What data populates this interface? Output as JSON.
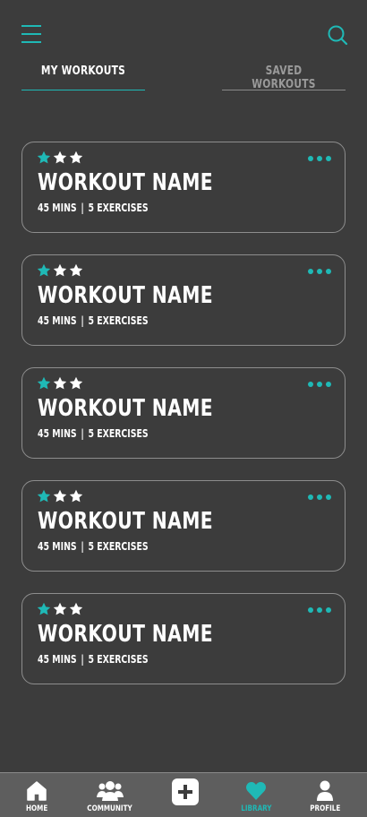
{
  "colors": {
    "background": "#3c3c3c",
    "accent": "#1fb9b6",
    "nav_bg": "#5e5e5e"
  },
  "header": {
    "menu_icon": "hamburger-icon",
    "search_icon": "search-icon"
  },
  "tabs": [
    {
      "label": "MY WORKOUTS",
      "active": true
    },
    {
      "label": "SAVED WORKOUTS",
      "active": false
    }
  ],
  "workouts": [
    {
      "title": "WORKOUT NAME",
      "duration": "45 MINS",
      "separator": "|",
      "exercises": "5 EXERCISES",
      "difficulty": 1,
      "max_difficulty": 3
    },
    {
      "title": "WORKOUT NAME",
      "duration": "45 MINS",
      "separator": "|",
      "exercises": "5 EXERCISES",
      "difficulty": 1,
      "max_difficulty": 3
    },
    {
      "title": "WORKOUT NAME",
      "duration": "45 MINS",
      "separator": "|",
      "exercises": "5 EXERCISES",
      "difficulty": 1,
      "max_difficulty": 3
    },
    {
      "title": "WORKOUT NAME",
      "duration": "45 MINS",
      "separator": "|",
      "exercises": "5 EXERCISES",
      "difficulty": 1,
      "max_difficulty": 3
    },
    {
      "title": "WORKOUT NAME",
      "duration": "45 MINS",
      "separator": "|",
      "exercises": "5 EXERCISES",
      "difficulty": 1,
      "max_difficulty": 3
    }
  ],
  "nav": [
    {
      "label": "HOME",
      "icon": "home-icon",
      "active": false
    },
    {
      "label": "COMMUNITY",
      "icon": "community-icon",
      "active": false
    },
    {
      "label": "",
      "icon": "add-icon",
      "active": false
    },
    {
      "label": "LIBRARY",
      "icon": "heart-icon",
      "active": true
    },
    {
      "label": "PROFILE",
      "icon": "profile-icon",
      "active": false
    }
  ]
}
